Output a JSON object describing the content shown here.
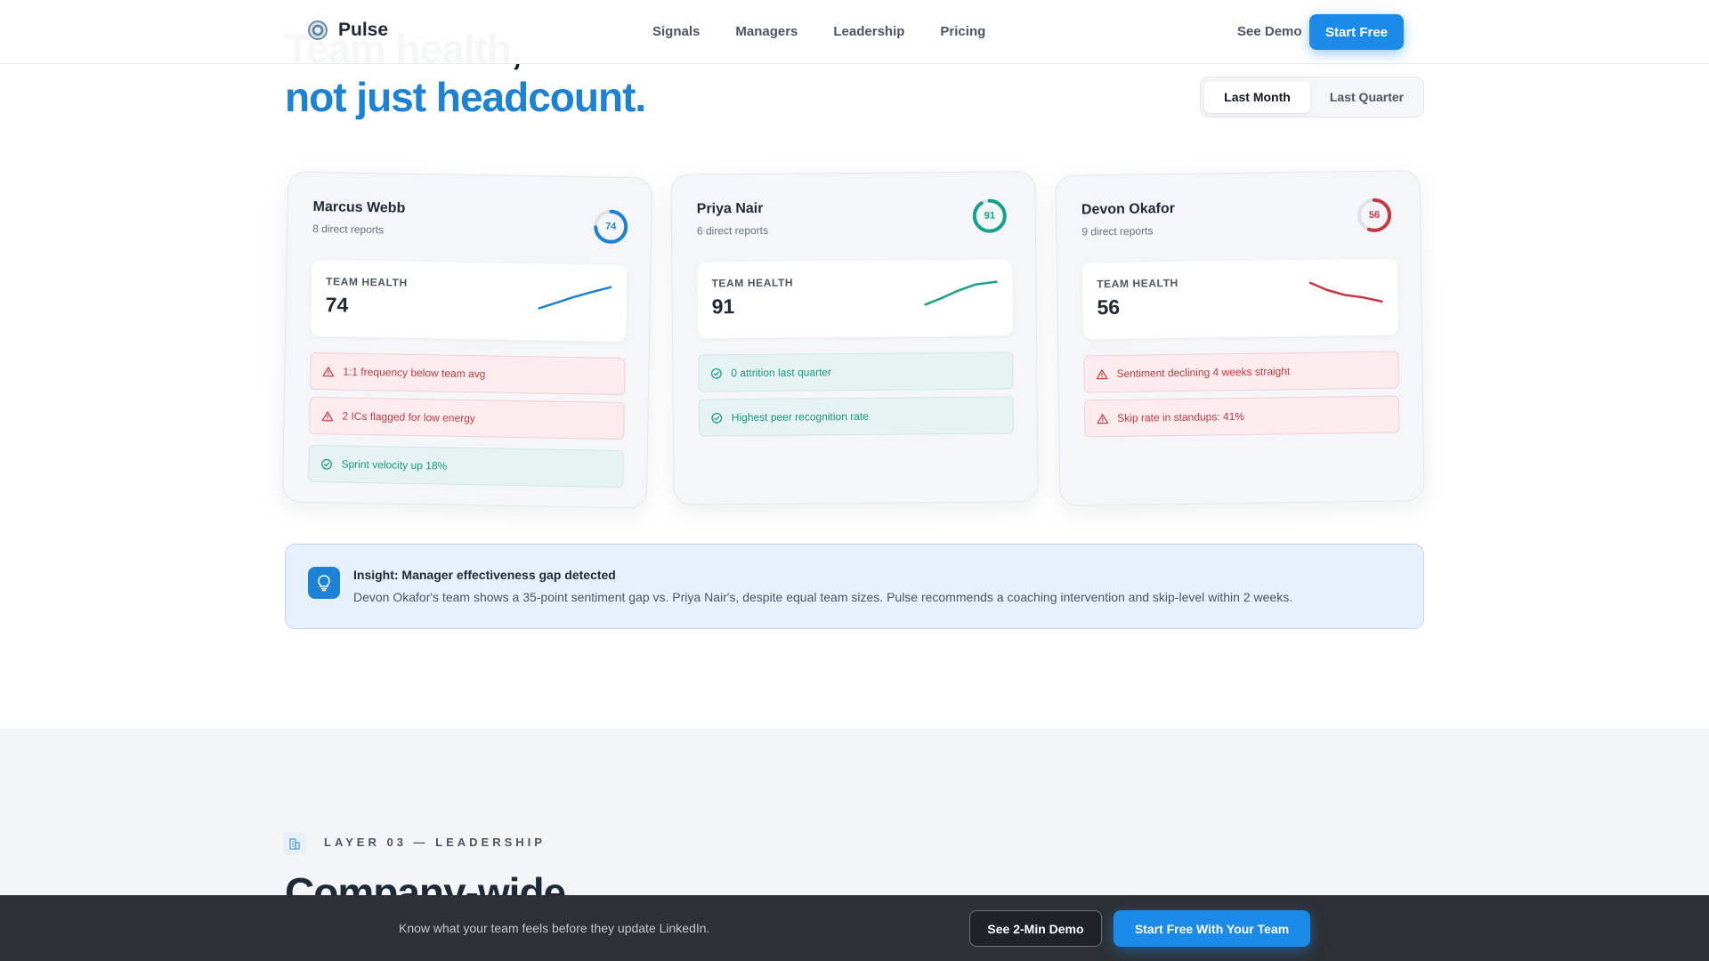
{
  "nav": {
    "brand": "Pulse",
    "links": [
      "Signals",
      "Managers",
      "Leadership",
      "Pricing"
    ],
    "see_demo": "See Demo",
    "start_free": "Start Free"
  },
  "hero": {
    "line1": "Team health,",
    "line2": "not just headcount."
  },
  "period_toggle": {
    "options": [
      "Last Month",
      "Last Quarter"
    ],
    "selected": "Last Month"
  },
  "managers": [
    {
      "name": "Marcus Webb",
      "reports": "8 direct reports",
      "score": "74",
      "score_fraction": 0.74,
      "color": "#1c82d6",
      "health_label": "TEAM HEALTH",
      "health_value": "74",
      "trend": "up",
      "signals": [
        {
          "type": "warn",
          "text": "1:1 frequency below team avg"
        },
        {
          "type": "warn",
          "text": "2 ICs flagged for low energy"
        },
        {
          "type": "ok",
          "text": "Sprint velocity up 18%"
        }
      ]
    },
    {
      "name": "Priya Nair",
      "reports": "6 direct reports",
      "score": "91",
      "score_fraction": 0.91,
      "color": "#14a388",
      "health_label": "TEAM HEALTH",
      "health_value": "91",
      "trend": "up",
      "signals": [
        {
          "type": "ok",
          "text": "0 attrition last quarter"
        },
        {
          "type": "ok",
          "text": "Highest peer recognition rate"
        }
      ]
    },
    {
      "name": "Devon Okafor",
      "reports": "9 direct reports",
      "score": "56",
      "score_fraction": 0.56,
      "color": "#c23a44",
      "health_label": "TEAM HEALTH",
      "health_value": "56",
      "trend": "down",
      "signals": [
        {
          "type": "warn",
          "text": "Sentiment declining 4 weeks straight"
        },
        {
          "type": "warn",
          "text": "Skip rate in standups: 41%"
        }
      ]
    }
  ],
  "insight": {
    "title": "Insight: Manager effectiveness gap detected",
    "text": "Devon Okafor's team shows a 35-point sentiment gap vs. Priya Nair's, despite equal team sizes. Pulse recommends a coaching intervention and skip-level within 2 weeks."
  },
  "layer": {
    "label": "LAYER 03 — LEADERSHIP",
    "title": "Company-wide"
  },
  "bottom_bar": {
    "text": "Know what your team feels before they update LinkedIn.",
    "demo_button": "See 2-Min Demo",
    "start_button": "Start Free With Your Team"
  },
  "icons": {
    "brand": "pulse-logo-icon",
    "warn": "alert-triangle-icon",
    "ok": "check-circle-icon",
    "insight": "lightbulb-icon",
    "layer": "building-icon"
  }
}
